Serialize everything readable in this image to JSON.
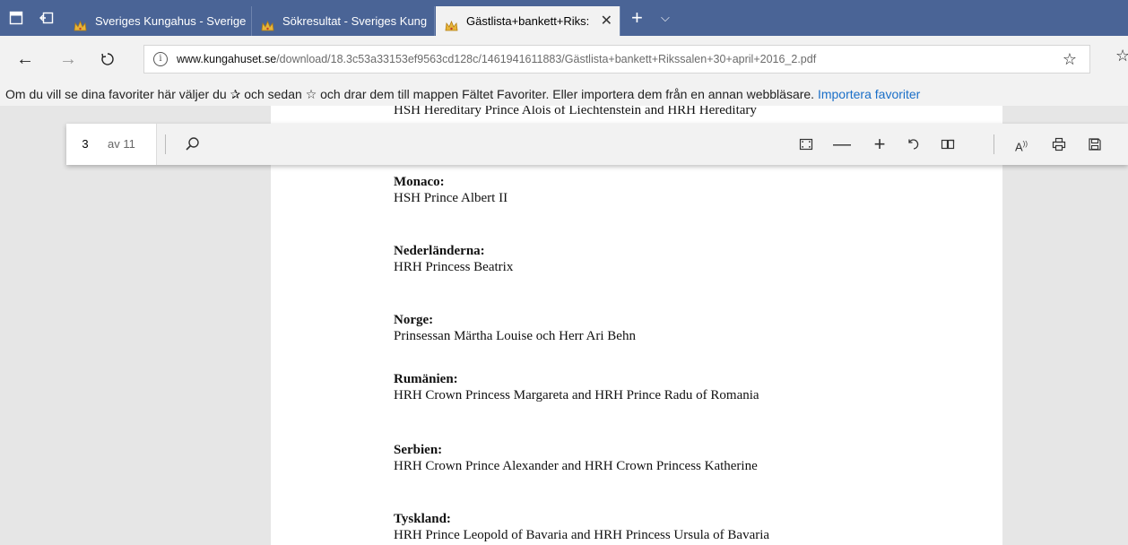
{
  "tabs": [
    {
      "title": "Sveriges Kungahus - Sverige",
      "active": false,
      "icon": "crown-icon"
    },
    {
      "title": "Sökresultat - Sveriges Kung",
      "active": false,
      "icon": "crown-icon"
    },
    {
      "title": "Gästlista+bankett+Riks:",
      "active": true,
      "icon": "crown-icon"
    }
  ],
  "tab_controls": {
    "close": "✕",
    "new_tab": "+",
    "tab_list": "⌵"
  },
  "address": {
    "host": "www.kungahuset.se",
    "path": "/download/18.3c53a33153ef9563cd128c/1461941611883/Gästlista+bankett+Rikssalen+30+april+2016_2.pdf"
  },
  "favorites_bar": {
    "text_1": "Om du vill se dina favoriter här väljer du",
    "glyph_1": "✰",
    "text_2": "och sedan",
    "glyph_2": "☆",
    "text_3": "och drar dem till mappen Fältet Favoriter. Eller importera dem från en annan webbläsare.",
    "link": "Importera favoriter"
  },
  "pdf_toolbar": {
    "page_value": "3",
    "page_count": "av 11"
  },
  "document": {
    "top_line": "HSH Hereditary Prince Alois of Liechtenstein and HRH Hereditary",
    "entries": [
      {
        "country": "Monaco:",
        "guests": "HSH Prince Albert II"
      },
      {
        "country": "Nederländerna:",
        "guests": "HRH Princess Beatrix"
      },
      {
        "country": "Norge:",
        "guests": "Prinsessan Märtha Louise och Herr Ari Behn"
      },
      {
        "country": "Rumänien:",
        "guests": "HRH Crown Princess Margareta and HRH Prince Radu of Romania"
      },
      {
        "country": "Serbien:",
        "guests": "HRH Crown Prince Alexander and HRH Crown Princess Katherine"
      },
      {
        "country": "Tyskland:",
        "guests": "HRH Prince Leopold of Bavaria and HRH Princess Ursula of Bavaria"
      }
    ]
  },
  "colors": {
    "tabbar": "#4a6496",
    "chrome": "#f2f2f2",
    "link": "#1a6fc8"
  }
}
